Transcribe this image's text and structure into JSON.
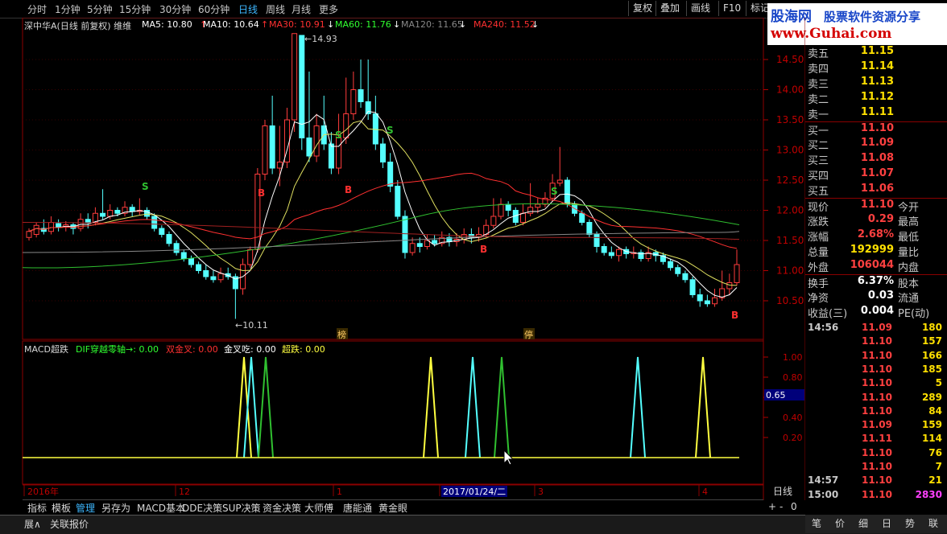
{
  "toolbar": {
    "periods": [
      "分时",
      "1分钟",
      "5分钟",
      "15分钟",
      "30分钟",
      "60分钟",
      "日线",
      "周线",
      "月线",
      "更多"
    ],
    "active_period": "日线",
    "right_buttons": [
      "复权",
      "叠加",
      "画线",
      "F10",
      "标记"
    ]
  },
  "watermark": {
    "brand": "股海网",
    "slogan": "股票软件资源分享",
    "url": "www.Guhai.com"
  },
  "main_chart": {
    "title": "深中华A(日线 前复权) 维维",
    "ma_labels": [
      {
        "text": "MA5: 10.80",
        "color": "#ffffff",
        "arrow": "↑"
      },
      {
        "text": "MA10: 10.64",
        "color": "#ffffff",
        "arrow": "↑"
      },
      {
        "text": "MA30: 10.91",
        "color": "#ff3030",
        "arrow": "↓"
      },
      {
        "text": "MA60: 11.76",
        "color": "#30ff30",
        "arrow": "↓"
      },
      {
        "text": "MA120: 11.65",
        "color": "#888888",
        "arrow": "↓"
      },
      {
        "text": "MA240: 11.52",
        "color": "#ff3030",
        "arrow": "↓"
      }
    ],
    "price_ticks": [
      "14.50",
      "14.00",
      "13.50",
      "13.00",
      "12.50",
      "12.00",
      "11.50",
      "11.00",
      "10.50"
    ],
    "high_label": "14.93",
    "low_label": "10.11",
    "signals": [
      {
        "text": "S",
        "color": "#30c030"
      },
      {
        "text": "B",
        "color": "#ff3030"
      },
      {
        "text": "S",
        "color": "#30c030"
      },
      {
        "text": "S",
        "color": "#30c030"
      },
      {
        "text": "B",
        "color": "#ff3030"
      },
      {
        "text": "B",
        "color": "#ff3030"
      },
      {
        "text": "S",
        "color": "#30c030"
      },
      {
        "text": "B",
        "color": "#ff3030"
      }
    ],
    "markers": [
      "榜",
      "停"
    ]
  },
  "macd": {
    "title": "MACD超跌",
    "items": [
      {
        "text": "DIF穿越零轴→: 0.00",
        "color": "#30ff30"
      },
      {
        "text": "双金叉: 0.00",
        "color": "#ff3030"
      },
      {
        "text": "金叉吃: 0.00",
        "color": "#ffffff"
      },
      {
        "text": "超跌: 0.00",
        "color": "#ffff40"
      }
    ],
    "ticks": [
      "1.00",
      "0.80",
      "0.60",
      "0.40",
      "0.20"
    ],
    "cursor_value": "0.65"
  },
  "date_axis": {
    "labels": [
      "2016年",
      "12",
      "1",
      "2017/01/24/二",
      "3",
      "4"
    ],
    "period_label": "日线"
  },
  "order_book": [
    {
      "label": "卖五",
      "price": "11.15"
    },
    {
      "label": "卖四",
      "price": "11.14"
    },
    {
      "label": "卖三",
      "price": "11.13"
    },
    {
      "label": "卖二",
      "price": "11.12"
    },
    {
      "label": "卖一",
      "price": "11.11"
    },
    {
      "label": "买一",
      "price": "11.10"
    },
    {
      "label": "买二",
      "price": "11.09"
    },
    {
      "label": "买三",
      "price": "11.08"
    },
    {
      "label": "买四",
      "price": "11.07"
    },
    {
      "label": "买五",
      "price": "11.06"
    }
  ],
  "quote": [
    {
      "label": "现价",
      "value": "11.10",
      "label2": "今开",
      "color": "#ff4040"
    },
    {
      "label": "涨跌",
      "value": "0.29",
      "label2": "最高",
      "color": "#ff4040"
    },
    {
      "label": "涨幅",
      "value": "2.68%",
      "label2": "最低",
      "color": "#ff4040"
    },
    {
      "label": "总量",
      "value": "192999",
      "label2": "量比",
      "color": "#ffe000"
    },
    {
      "label": "外盘",
      "value": "106044",
      "label2": "内盘",
      "color": "#ff4040"
    },
    {
      "label": "换手",
      "value": "6.37%",
      "label2": "股本",
      "color": "#ffffff"
    },
    {
      "label": "净资",
      "value": "0.03",
      "label2": "流通",
      "color": "#ffffff"
    },
    {
      "label": "收益(三)",
      "value": "0.004",
      "label2": "PE(动)",
      "color": "#ffffff"
    }
  ],
  "ticks": [
    {
      "time": "14:56",
      "price": "11.09",
      "vol": "180"
    },
    {
      "time": "",
      "price": "11.10",
      "vol": "157"
    },
    {
      "time": "",
      "price": "11.10",
      "vol": "166"
    },
    {
      "time": "",
      "price": "11.10",
      "vol": "185"
    },
    {
      "time": "",
      "price": "11.10",
      "vol": "5"
    },
    {
      "time": "",
      "price": "11.10",
      "vol": "289"
    },
    {
      "time": "",
      "price": "11.10",
      "vol": "84"
    },
    {
      "time": "",
      "price": "11.09",
      "vol": "159"
    },
    {
      "time": "",
      "price": "11.11",
      "vol": "114"
    },
    {
      "time": "",
      "price": "11.10",
      "vol": "76"
    },
    {
      "time": "",
      "price": "11.10",
      "vol": "7"
    },
    {
      "time": "14:57",
      "price": "11.10",
      "vol": "21"
    },
    {
      "time": "15:00",
      "price": "11.10",
      "vol": "2830"
    }
  ],
  "bottom_tabs": [
    "指标",
    "模板",
    "管理",
    "另存为",
    "MACD基本",
    "DDE决策",
    "SUP决策",
    "资金决策",
    "大师傅",
    "唐能通",
    "黄金眼"
  ],
  "bottom_selected": "管理",
  "bottom_controls": [
    "+",
    "-",
    "0"
  ],
  "status": {
    "left1": "展∧",
    "left2": "关联报价"
  },
  "right_tabs": [
    "笔",
    "价",
    "细",
    "日",
    "势",
    "联"
  ]
}
